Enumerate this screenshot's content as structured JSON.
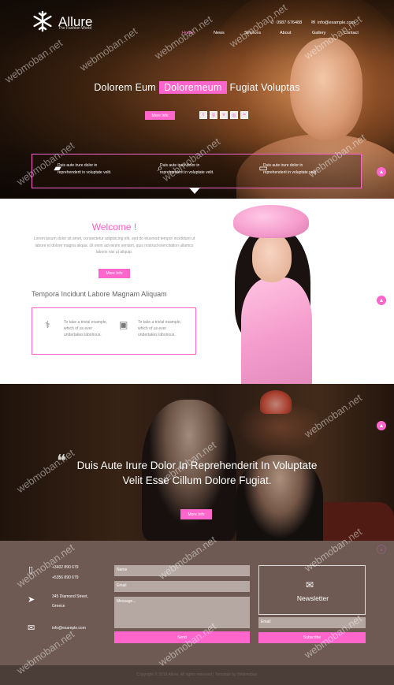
{
  "header": {
    "brand": "Allure",
    "tagline": "The Fashion World",
    "phone": "0987 676488",
    "email": "info@example.com",
    "nav": [
      {
        "label": "Home",
        "active": true
      },
      {
        "label": "News"
      },
      {
        "label": "Services"
      },
      {
        "label": "About"
      },
      {
        "label": "Gallery"
      },
      {
        "label": "Contact"
      }
    ]
  },
  "hero": {
    "title_before": "Dolorem Eum",
    "title_highlight": "Doloremeum",
    "title_after": "Fugiat Voluptas",
    "more_label": "More Info",
    "social": [
      "twitter-icon",
      "google-plus-icon",
      "vimeo-icon",
      "dribbble-icon",
      "flickr-icon"
    ],
    "features": [
      {
        "icon": "folder-icon",
        "text": "Duis aute irure dolor in reprehenderit in voluptate velit."
      },
      {
        "icon": "search-icon",
        "text": "Duis aute irure dolor in reprehenderit in voluptate velit."
      },
      {
        "icon": "monitor-icon",
        "text": "Duis aute irure dolor in reprehenderit in voluptate velit."
      }
    ]
  },
  "welcome": {
    "title": "Welcome !",
    "text": "Lorem ipsum dolor sit amet, consectetur adipisicing elit, sed do eiusmod tempor incididunt ut labore et dolore magna aliqua. Ut enim ad minim veniam, quis nostrud exercitation ullamco laboris nisi ut aliquip.",
    "more_label": "More Info",
    "subtitle": "Tempora Incidunt Labore Magnam Aliquam",
    "items": [
      {
        "icon": "caduceus-icon",
        "text": "To take a trivial example, which of us ever undertakes laborious."
      },
      {
        "icon": "image-icon",
        "text": "To take a trivial example, which of us ever undertakes laborious."
      }
    ]
  },
  "banner": {
    "quote": "Duis Aute Irure Dolor In Reprehenderit In Voluptate Velit Esse Cillum Dolore Fugiat.",
    "more_label": "More Info"
  },
  "footer": {
    "phone1": "+3402 890 679",
    "phone2": "+5356 890 679",
    "address1": "345 Diamond Street,",
    "address2": "Greece",
    "email": "info@example.com",
    "name_placeholder": "Name",
    "email_placeholder": "Email",
    "message_placeholder": "Message...",
    "send_label": "Send",
    "newsletter_title": "Newsletter",
    "newsletter_email_placeholder": "Email",
    "subscribe_label": "Subscribe",
    "copyright": "Copyright © 2016 Allure. All rights reserved | Template by Webmoban"
  },
  "watermark": "webmoban.net",
  "colors": {
    "accent": "#ff66cc",
    "footer": "#6e5a52",
    "footer_bottom": "#4b3e39"
  }
}
